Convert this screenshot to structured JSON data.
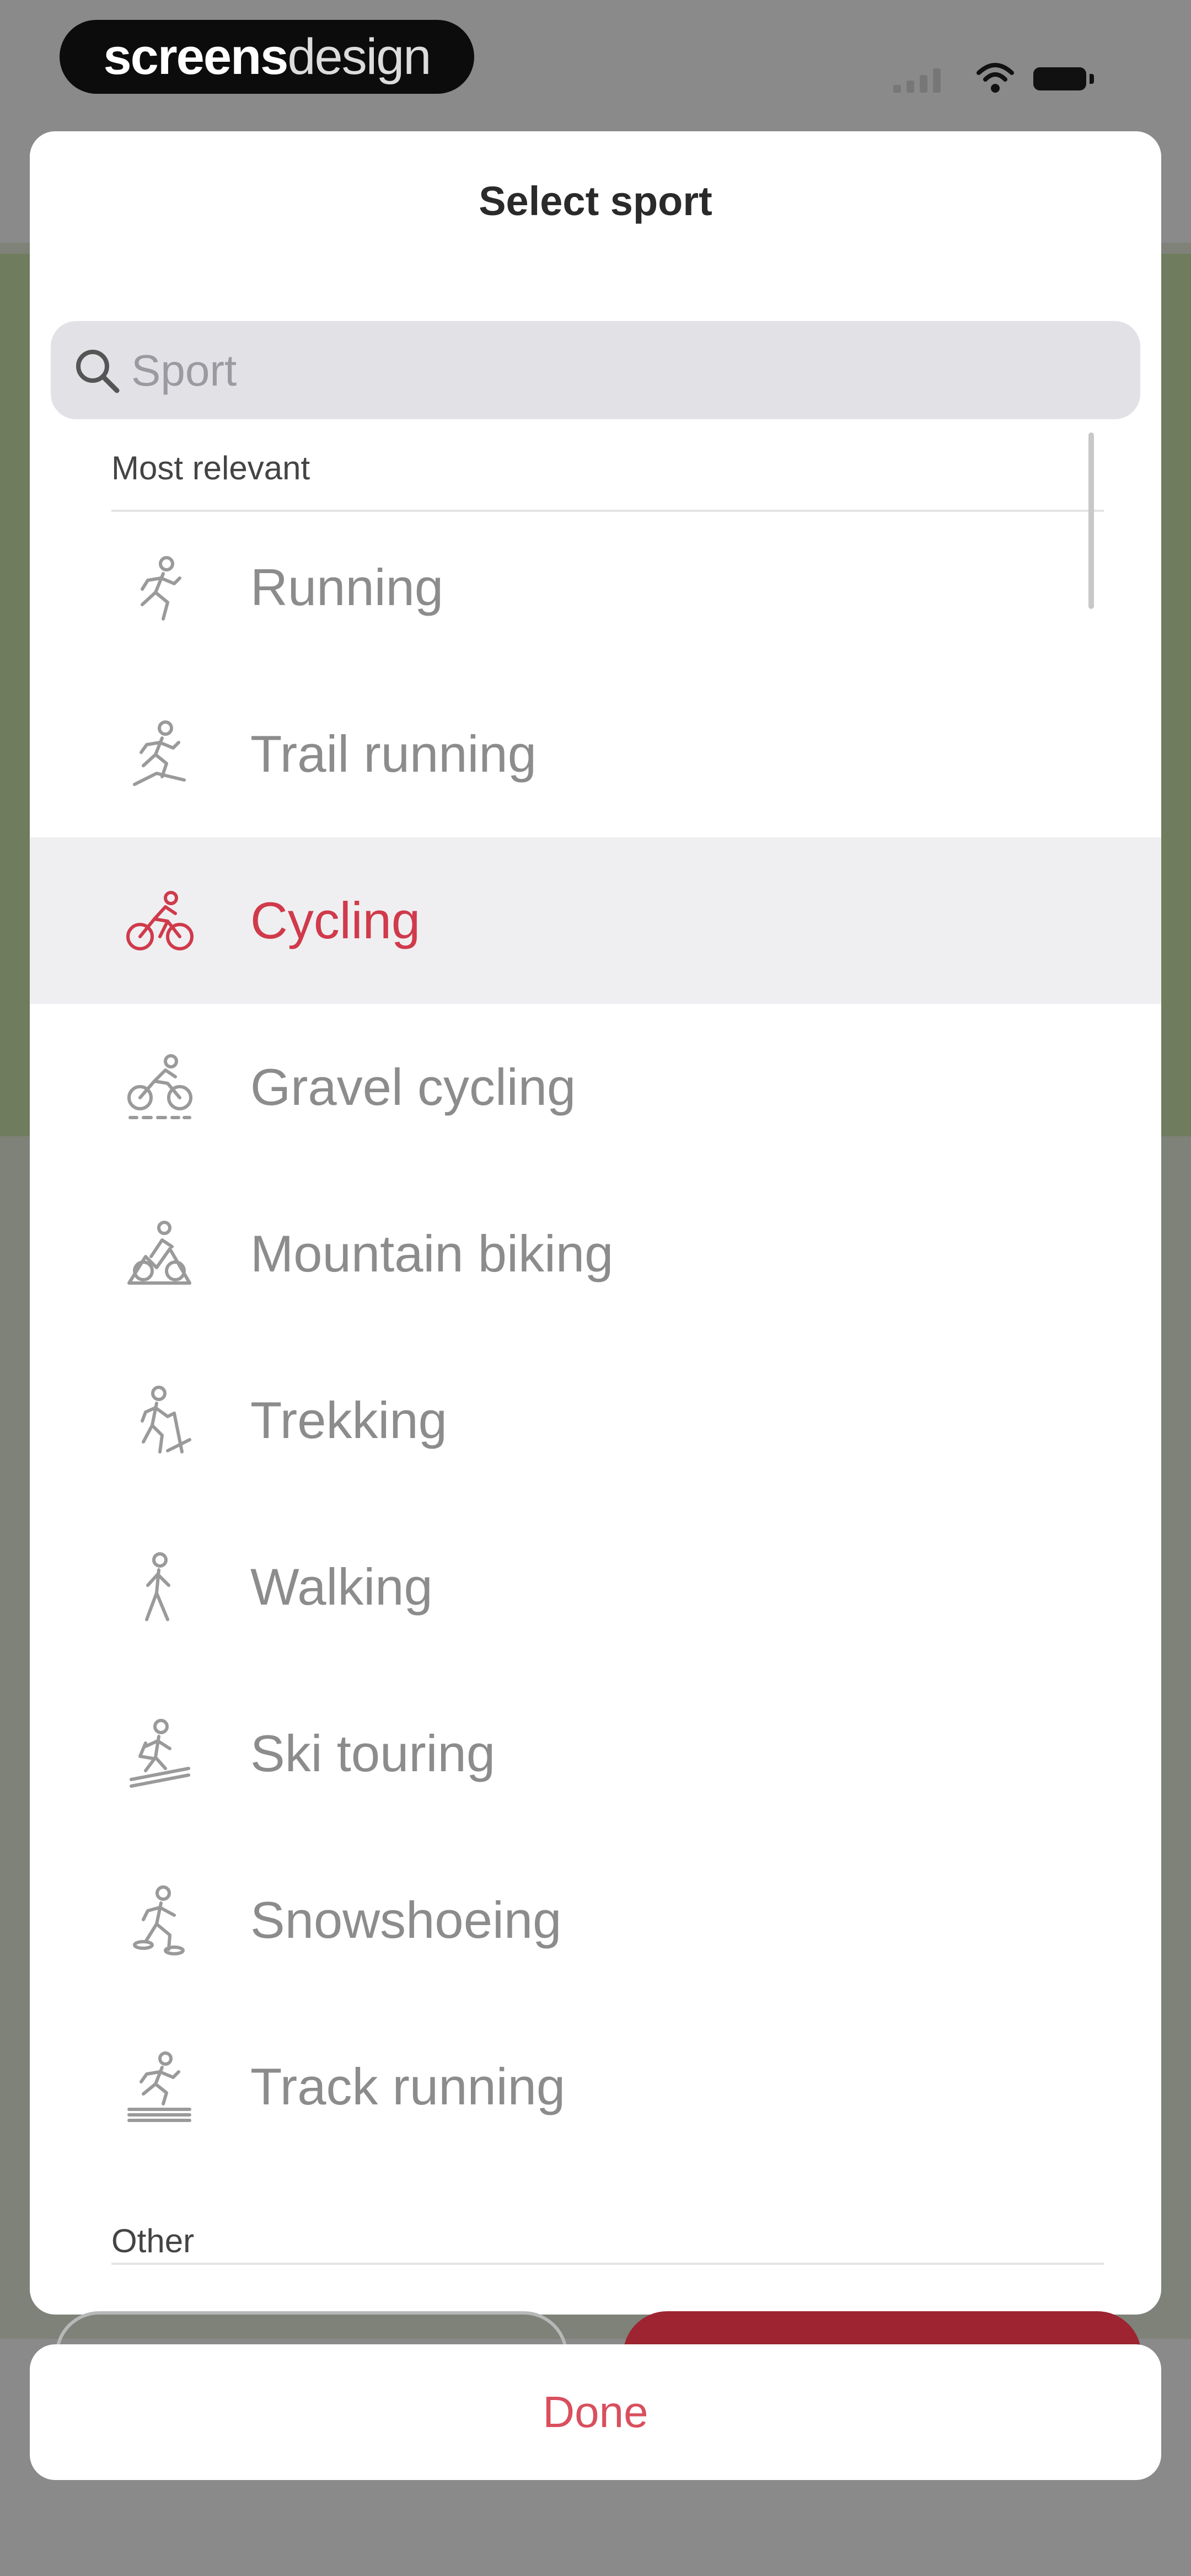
{
  "brand": {
    "main": "screens",
    "accent": "design"
  },
  "status_bar": {
    "wifi_icon": "wifi-icon",
    "battery_icon": "battery-icon",
    "signal_icon": "signal-icon"
  },
  "sheet": {
    "title": "Select sport",
    "search": {
      "placeholder": "Sport",
      "value": "",
      "icon": "search-icon"
    },
    "sections": [
      {
        "header": "Most relevant"
      },
      {
        "header": "Other"
      }
    ],
    "items": [
      {
        "label": "Running",
        "icon": "running-icon",
        "selected": false
      },
      {
        "label": "Trail running",
        "icon": "trail-running-icon",
        "selected": false
      },
      {
        "label": "Cycling",
        "icon": "cycling-icon",
        "selected": true
      },
      {
        "label": "Gravel cycling",
        "icon": "gravel-cycling-icon",
        "selected": false
      },
      {
        "label": "Mountain biking",
        "icon": "mountain-biking-icon",
        "selected": false
      },
      {
        "label": "Trekking",
        "icon": "trekking-icon",
        "selected": false
      },
      {
        "label": "Walking",
        "icon": "walking-icon",
        "selected": false
      },
      {
        "label": "Ski touring",
        "icon": "ski-touring-icon",
        "selected": false
      },
      {
        "label": "Snowshoeing",
        "icon": "snowshoeing-icon",
        "selected": false
      },
      {
        "label": "Track running",
        "icon": "track-running-icon",
        "selected": false
      }
    ]
  },
  "done_button": {
    "label": "Done"
  },
  "colors": {
    "accent": "#d03a4b",
    "item_text": "#8c8c8c",
    "selected_bg": "#efeff1",
    "search_bg": "#e2e2e6"
  }
}
